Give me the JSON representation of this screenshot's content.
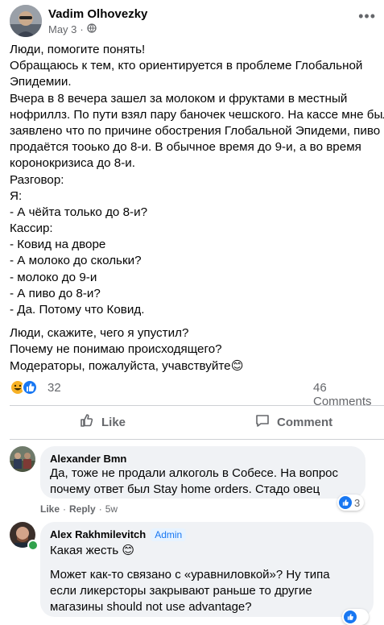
{
  "post": {
    "author": "Vadim Olhovezky",
    "date": "May 3",
    "separator": "·",
    "privacy_icon": "globe-icon",
    "more_icon": "more-dots-icon",
    "lines": [
      "Люди, помогите понять!",
      "Обращаюсь к тем, кто ориентируется в проблеме Глобальной",
      "Эпидемии.",
      "Вчера в 8 вечера зашел за молоком и фруктами в местный",
      "нофриллз. По пути взял пару баночек чешского. На кассе мне было",
      "заявлено что по причине обострения Глобальной Эпидеми, пиво",
      "продаётся тооько до 8-и. В обычное время до 9-и, а во время",
      "коронокризиса до 8-и.",
      "Разговор:",
      "Я:",
      "- А чёйта только до 8-и?",
      "Кассир:",
      "- Ковид на дворе",
      "- А молоко до скольки?",
      "- молоко до 9-и",
      "- А пиво до 8-и?",
      "- Да. Потому что Ковид."
    ],
    "lines2": [
      "Люди, скажите, чего я упустил?",
      "Почему не понимаю происходящего?",
      "Модераторы, пожалуйста, учавствуйте😊"
    ],
    "reaction_count": "32",
    "comment_count": "46 Comments"
  },
  "actions": {
    "like_label": "Like",
    "comment_label": "Comment"
  },
  "comments": [
    {
      "author": "Alexander Bmn",
      "lines": [
        "Да, тоже не продали алкоголь в Собесе. На вопрос",
        "почему ответ был Stay home orders. Стадо овец"
      ],
      "like_label": "Like",
      "dot": "·",
      "reply_label": "Reply",
      "time": "5w",
      "reaction_count": "3"
    },
    {
      "author": "Alex Rakhmilevitch",
      "badge": "Admin",
      "line1": "Какая жесть 😊",
      "lines": [
        "Может как-то связано с «уравниловкой»? Ну типа",
        "если ликерсторы закрывают раньше то другие",
        "магазины should not use advantage?"
      ]
    }
  ],
  "colors": {
    "accent": "#1877f2",
    "secondary_text": "#65676b",
    "bubble_bg": "#f0f2f5"
  }
}
